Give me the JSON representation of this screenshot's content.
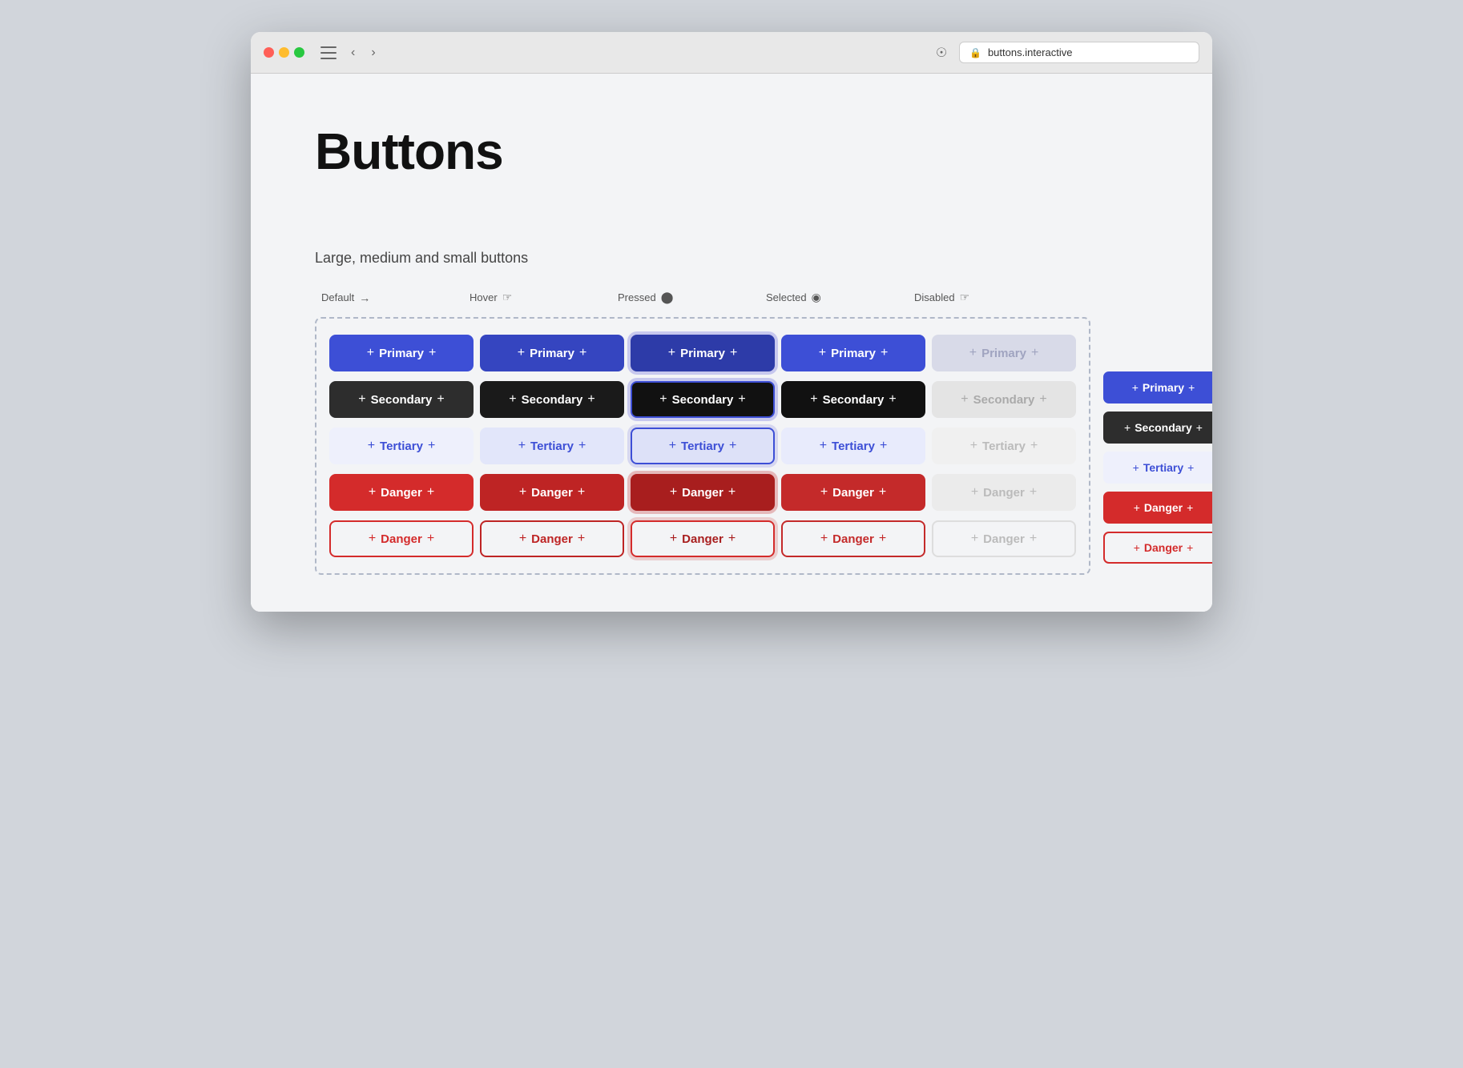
{
  "browser": {
    "url": "buttons.interactive",
    "title": "Buttons"
  },
  "page": {
    "title": "Buttons",
    "subtitle": "Large, medium and small buttons"
  },
  "states": {
    "labels": [
      "Default",
      "Hover",
      "Pressed",
      "Selected",
      "Disabled"
    ]
  },
  "button_types": [
    "Primary",
    "Secondary",
    "Tertiary",
    "Danger",
    "Danger"
  ],
  "rows": [
    {
      "label": "Primary",
      "variant": "primary",
      "states": [
        "default",
        "hover",
        "pressed",
        "selected",
        "disabled"
      ]
    },
    {
      "label": "Secondary",
      "variant": "secondary",
      "states": [
        "default",
        "hover",
        "pressed",
        "selected",
        "disabled"
      ]
    },
    {
      "label": "Tertiary",
      "variant": "tertiary",
      "states": [
        "default",
        "hover",
        "pressed",
        "selected",
        "disabled"
      ]
    },
    {
      "label": "Danger",
      "variant": "danger",
      "states": [
        "default",
        "hover",
        "pressed",
        "selected",
        "disabled"
      ]
    },
    {
      "label": "Danger",
      "variant": "danger-outline",
      "states": [
        "default",
        "hover",
        "pressed",
        "selected",
        "disabled"
      ]
    }
  ],
  "right_columns": {
    "labels": [
      "",
      "",
      ""
    ],
    "rows": [
      {
        "label": "Primary",
        "classes": [
          "btn-sm-primary-default",
          "btn-sm-primary-hover",
          "btn-sm-primary-pressed"
        ]
      },
      {
        "label": "Secondary",
        "classes": [
          "btn-sm-secondary-default",
          "btn-sm-secondary-hover",
          "btn-sm-secondary-pressed"
        ]
      },
      {
        "label": "Tertiary",
        "classes": [
          "btn-sm-tertiary-default",
          "btn-sm-tertiary-hover",
          "btn-sm-tertiary-pressed"
        ]
      },
      {
        "label": "Danger",
        "classes": [
          "btn-sm-danger-default",
          "btn-sm-danger-hover",
          "btn-sm-danger-pressed"
        ]
      },
      {
        "label": "Danger",
        "classes": [
          "btn-sm-danger-outline-default",
          "btn-sm-danger-outline-hover",
          "btn-sm-danger-outline-pressed"
        ]
      }
    ]
  }
}
